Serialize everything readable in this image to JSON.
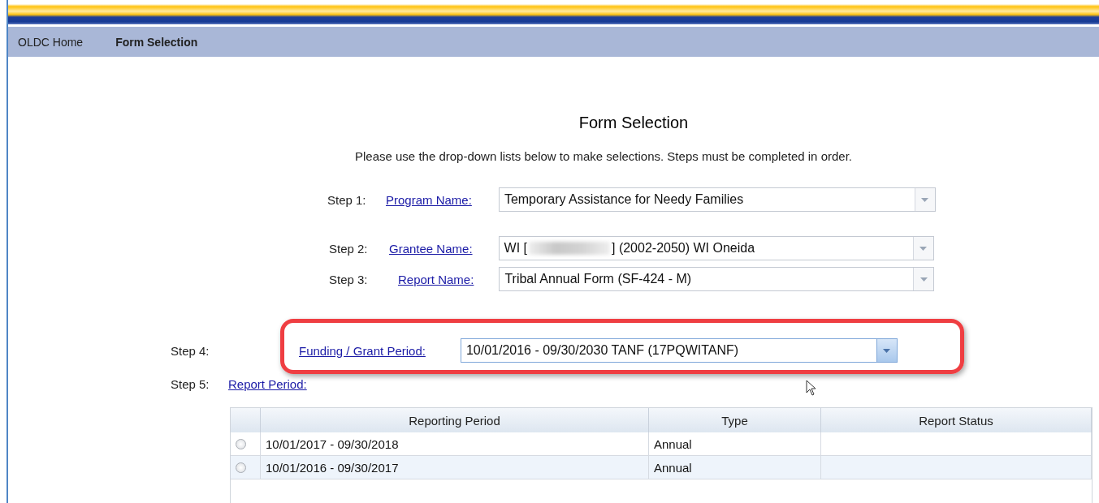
{
  "nav": [
    {
      "label": "OLDC Home",
      "selected": false
    },
    {
      "label": "Form Selection",
      "selected": true
    }
  ],
  "title": "Form Selection",
  "instructions": "Please use the drop-down lists below to make selections. Steps must be completed in order.",
  "steps": [
    {
      "step": "Step 1:",
      "link": "Program Name:",
      "value": "Temporary Assistance for Needy Families",
      "focused": false
    },
    {
      "step": "Step 2:",
      "link": "Grantee Name:",
      "value": "WI [",
      "redacted": true,
      "value_after": "] (2002-2050) WI Oneida",
      "focused": false
    },
    {
      "step": "Step 3:",
      "link": "Report Name:",
      "value": "Tribal Annual Form (SF-424 - M)",
      "focused": false
    },
    {
      "step": "Step 4:",
      "link": "Funding / Grant Period:",
      "value": "10/01/2016 - 09/30/2030 TANF (17PQWITANF)",
      "focused": true,
      "highlighted": true
    }
  ],
  "step5": {
    "step": "Step 5:",
    "link": "Report Period:"
  },
  "table": {
    "columns": [
      "Reporting Period",
      "Type",
      "Report Status"
    ],
    "rows": [
      {
        "selected": false,
        "cells": [
          "10/01/2017 - 09/30/2018",
          "Annual"
        ]
      },
      {
        "selected": false,
        "cells": [
          "10/01/2016 - 09/30/2017",
          "Annual"
        ]
      }
    ]
  }
}
